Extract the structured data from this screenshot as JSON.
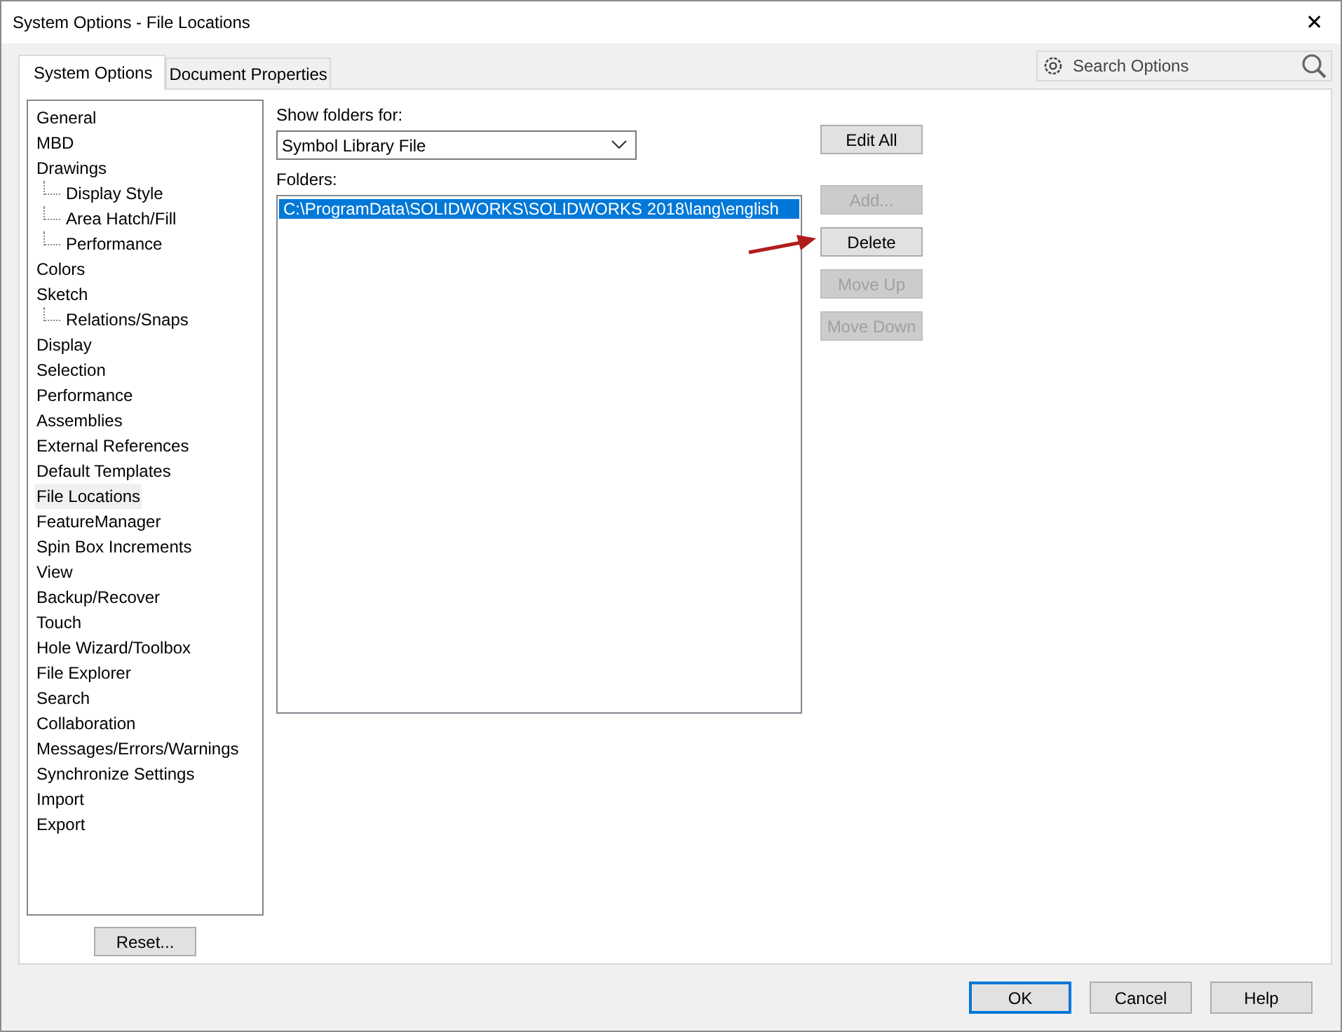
{
  "window": {
    "title": "System Options - File Locations",
    "close": "✕"
  },
  "tabs": [
    {
      "label": "System Options",
      "selected": true
    },
    {
      "label": "Document Properties",
      "selected": false
    }
  ],
  "search": {
    "placeholder": "Search Options"
  },
  "tree": [
    {
      "label": "General",
      "selected": false
    },
    {
      "label": "MBD",
      "selected": false
    },
    {
      "label": "Drawings",
      "selected": false,
      "children": [
        {
          "label": "Display Style",
          "selected": false
        },
        {
          "label": "Area Hatch/Fill",
          "selected": false
        },
        {
          "label": "Performance",
          "selected": false
        }
      ]
    },
    {
      "label": "Colors",
      "selected": false
    },
    {
      "label": "Sketch",
      "selected": false,
      "children": [
        {
          "label": "Relations/Snaps",
          "selected": false
        }
      ]
    },
    {
      "label": "Display",
      "selected": false
    },
    {
      "label": "Selection",
      "selected": false
    },
    {
      "label": "Performance",
      "selected": false
    },
    {
      "label": "Assemblies",
      "selected": false
    },
    {
      "label": "External References",
      "selected": false
    },
    {
      "label": "Default Templates",
      "selected": false
    },
    {
      "label": "File Locations",
      "selected": true
    },
    {
      "label": "FeatureManager",
      "selected": false
    },
    {
      "label": "Spin Box Increments",
      "selected": false
    },
    {
      "label": "View",
      "selected": false
    },
    {
      "label": "Backup/Recover",
      "selected": false
    },
    {
      "label": "Touch",
      "selected": false
    },
    {
      "label": "Hole Wizard/Toolbox",
      "selected": false
    },
    {
      "label": "File Explorer",
      "selected": false
    },
    {
      "label": "Search",
      "selected": false
    },
    {
      "label": "Collaboration",
      "selected": false
    },
    {
      "label": "Messages/Errors/Warnings",
      "selected": false
    },
    {
      "label": "Synchronize Settings",
      "selected": false
    },
    {
      "label": "Import",
      "selected": false
    },
    {
      "label": "Export",
      "selected": false
    }
  ],
  "reset_button": "Reset...",
  "show_folders_for": {
    "label": "Show folders for:",
    "value": "Symbol Library File"
  },
  "edit_all_button": "Edit All",
  "folders": {
    "label": "Folders:",
    "items": [
      {
        "path": "C:\\ProgramData\\SOLIDWORKS\\SOLIDWORKS 2018\\lang\\english",
        "selected": true
      }
    ]
  },
  "folder_buttons": [
    {
      "label": "Add...",
      "disabled": true
    },
    {
      "label": "Delete",
      "disabled": false
    },
    {
      "label": "Move Up",
      "disabled": true
    },
    {
      "label": "Move Down",
      "disabled": true
    }
  ],
  "footer_buttons": [
    {
      "label": "OK",
      "default": true
    },
    {
      "label": "Cancel",
      "default": false
    },
    {
      "label": "Help",
      "default": false
    }
  ]
}
